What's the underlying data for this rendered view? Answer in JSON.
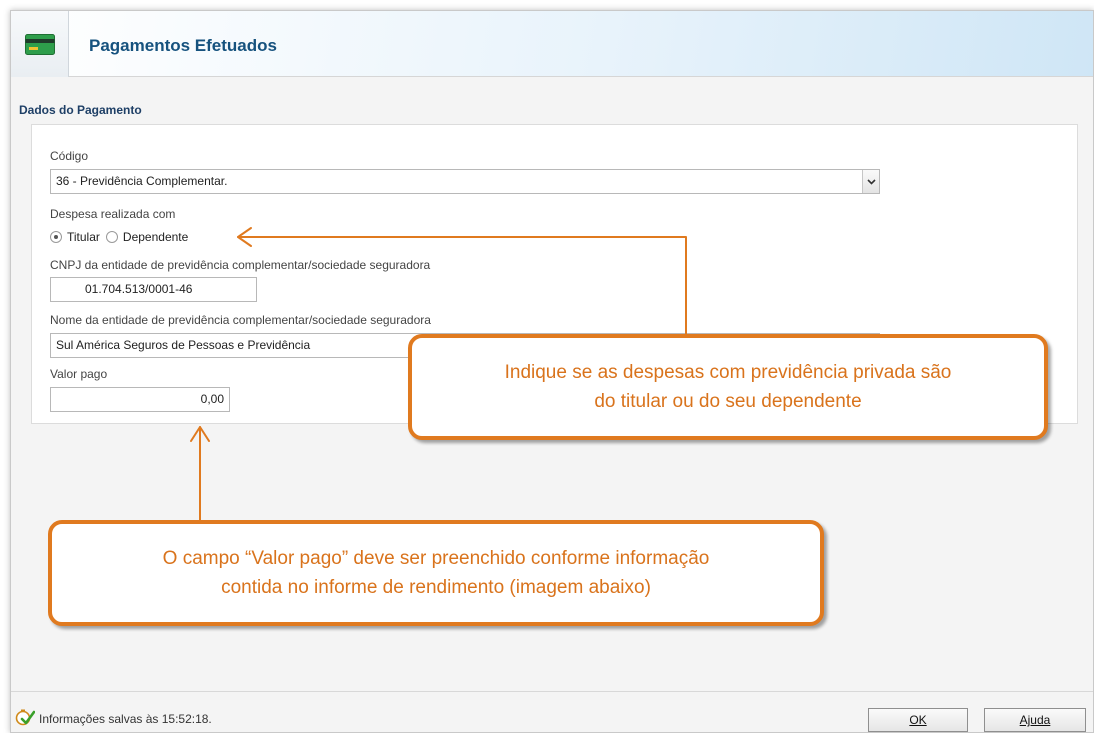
{
  "window": {
    "title": "Pagamentos Efetuados"
  },
  "section": {
    "heading": "Dados do Pagamento"
  },
  "form": {
    "codigo_label": "Código",
    "codigo_value": "36 - Previdência Complementar.",
    "despesa_label": "Despesa realizada com",
    "radio_titular": "Titular",
    "radio_dependente": "Dependente",
    "selected": "Titular",
    "cnpj_label": "CNPJ da entidade de previdência complementar/sociedade seguradora",
    "cnpj_value": "01.704.513/0001-46",
    "nome_label": "Nome da entidade de previdência complementar/sociedade seguradora",
    "nome_value": "Sul América Seguros de Pessoas e Previdência",
    "valor_label": "Valor pago",
    "valor_value": "0,00"
  },
  "callouts": {
    "dependente_line1": "Indique se as despesas com previdência privada são",
    "dependente_line2": "do titular ou do seu dependente",
    "valor_line1": "O campo “Valor pago” deve ser preenchido conforme informação",
    "valor_line2": "contida no informe de rendimento (imagem abaixo)"
  },
  "status": {
    "text": "Informações salvas às 15:52:18."
  },
  "buttons": {
    "ok": "OK",
    "ajuda": "Ajuda"
  },
  "colors": {
    "accent": "#e07a1f",
    "title": "#16527e",
    "heading": "#1e3f66"
  }
}
